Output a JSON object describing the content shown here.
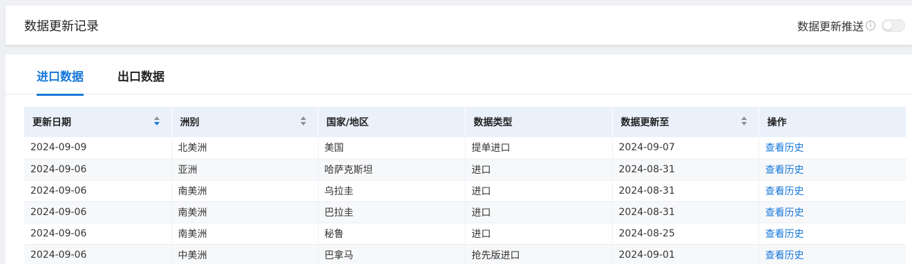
{
  "header": {
    "title": "数据更新记录",
    "push_label": "数据更新推送",
    "info_icon": "info-icon",
    "push_enabled": false
  },
  "tabs": [
    {
      "label": "进口数据",
      "active": true
    },
    {
      "label": "出口数据",
      "active": false
    }
  ],
  "table": {
    "columns": [
      {
        "label": "更新日期",
        "sortable": true
      },
      {
        "label": "洲别",
        "sortable": true
      },
      {
        "label": "国家/地区",
        "sortable": false
      },
      {
        "label": "数据类型",
        "sortable": false
      },
      {
        "label": "数据更新至",
        "sortable": true
      },
      {
        "label": "操作",
        "sortable": false
      }
    ],
    "rows": [
      {
        "date": "2024-09-09",
        "continent": "北美洲",
        "country": "美国",
        "type": "提单进口",
        "updated_to": "2024-09-07",
        "action": "查看历史"
      },
      {
        "date": "2024-09-06",
        "continent": "亚洲",
        "country": "哈萨克斯坦",
        "type": "进口",
        "updated_to": "2024-08-31",
        "action": "查看历史"
      },
      {
        "date": "2024-09-06",
        "continent": "南美洲",
        "country": "乌拉圭",
        "type": "进口",
        "updated_to": "2024-08-31",
        "action": "查看历史"
      },
      {
        "date": "2024-09-06",
        "continent": "南美洲",
        "country": "巴拉圭",
        "type": "进口",
        "updated_to": "2024-08-31",
        "action": "查看历史"
      },
      {
        "date": "2024-09-06",
        "continent": "南美洲",
        "country": "秘鲁",
        "type": "进口",
        "updated_to": "2024-08-25",
        "action": "查看历史"
      },
      {
        "date": "2024-09-06",
        "continent": "中美洲",
        "country": "巴拿马",
        "type": "抢先版进口",
        "updated_to": "2024-09-01",
        "action": "查看历史"
      }
    ]
  },
  "colors": {
    "accent": "#1677d9",
    "header_bg": "#eaf1fb"
  }
}
